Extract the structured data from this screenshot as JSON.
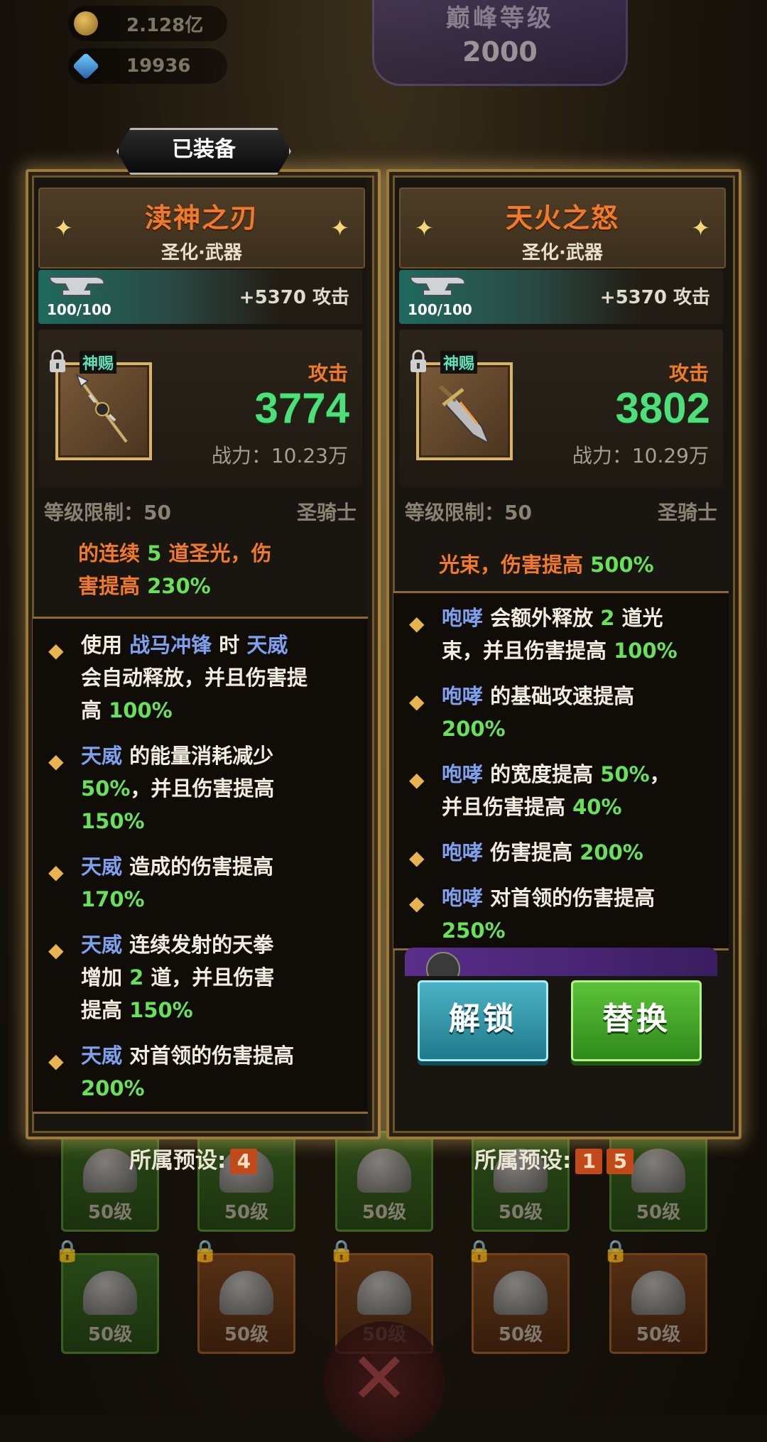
{
  "hud": {
    "gold": "2.128亿",
    "gems": "19936",
    "peak_title": "巅峰等级",
    "peak_value": "2000"
  },
  "equipped_tag": "已装备",
  "background_slot_level": "50级",
  "left_item": {
    "name": "渎神之刃",
    "subtitle": "圣化·武器",
    "forge_count": "100/100",
    "forge_bonus": "+5370 攻击",
    "divine_label": "神赐",
    "stat_label": "攻击",
    "stat_value": "3774",
    "power": "战力：10.23万",
    "level_req": "等级限制：50",
    "class": "圣骑士",
    "set_effect": {
      "a": "的连续 ",
      "n1": "5",
      "b": " 道圣光，伤",
      "c": "害提高 ",
      "n2": "230%"
    },
    "perks": [
      {
        "t1": "使用 ",
        "k1": "战马冲锋",
        "t2": " 时 ",
        "k2": "天威",
        "t3": "会自动释放，并且伤害提高 ",
        "n1": "100%"
      },
      {
        "k1": "天威",
        "t1": " 的能量消耗减少 ",
        "n1": "50%",
        "t2": "，并且伤害提高 ",
        "n2": "150%"
      },
      {
        "k1": "天威",
        "t1": " 造成的伤害提高 ",
        "n1": "170%"
      },
      {
        "k1": "天威",
        "t1": " 连续发射的天拳增加 ",
        "n1": "2",
        "t2": " 道，并且伤害提高 ",
        "n2": "150%"
      },
      {
        "k1": "天威",
        "t1": " 对首领的伤害提高 ",
        "n1": "200%"
      }
    ],
    "preset_label": "所属预设:",
    "presets": [
      "4"
    ]
  },
  "right_item": {
    "name": "天火之怒",
    "subtitle": "圣化·武器",
    "forge_count": "100/100",
    "forge_bonus": "+5370 攻击",
    "divine_label": "神赐",
    "stat_label": "攻击",
    "stat_value": "3802",
    "power": "战力：10.29万",
    "level_req": "等级限制：50",
    "class": "圣骑士",
    "set_effect": {
      "a": "光束，伤害提高 ",
      "n1": "500%"
    },
    "perks": [
      {
        "k1": "咆哮",
        "t1": " 会额外释放 ",
        "n1": "2",
        "t2": " 道光束，并且伤害提高 ",
        "n2": "100%"
      },
      {
        "k1": "咆哮",
        "t1": " 的基础攻速提高 ",
        "n1": "200%"
      },
      {
        "k1": "咆哮",
        "t1": " 的宽度提高 ",
        "n1": "50%",
        "t2": "，并且伤害提高 ",
        "n2": "40%"
      },
      {
        "k1": "咆哮",
        "t1": " 伤害提高 ",
        "n1": "200%"
      },
      {
        "k1": "咆哮",
        "t1": " 对首领的伤害提高 ",
        "n1": "250%"
      }
    ],
    "unlock_label": "解锁",
    "replace_label": "替换",
    "preset_label": "所属预设:",
    "presets": [
      "1",
      "5"
    ]
  }
}
